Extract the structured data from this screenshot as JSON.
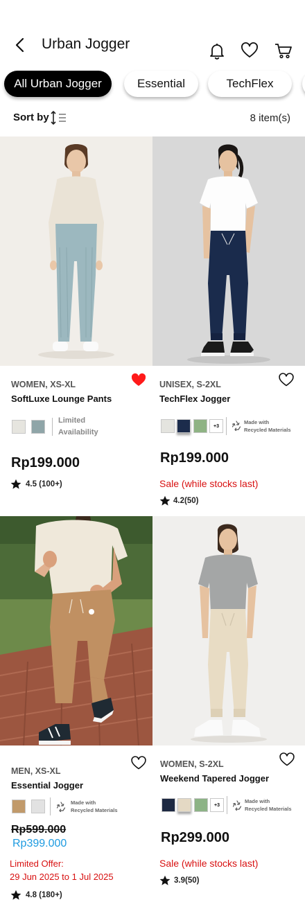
{
  "header": {
    "title": "Urban Jogger"
  },
  "chips": [
    "All Urban Jogger",
    "Essential",
    "TechFlex"
  ],
  "sort": {
    "label": "Sort by",
    "count": "8 item(s)"
  },
  "eco_label_line1": "Made with",
  "eco_label_line2": "Recycled Materials",
  "products": [
    {
      "category": "WOMEN, XS-XL",
      "name": "SoftLuxe Lounge Pants",
      "favorited": true,
      "swatches": [
        "#e6e5df",
        "#8fa5a8"
      ],
      "limited_line1": "Limited",
      "limited_line2": "Availability",
      "price": "Rp199.000",
      "rating": "4.5 (100+)"
    },
    {
      "category": "UNISEX, S-2XL",
      "name": "TechFlex Jogger",
      "favorited": false,
      "swatches": [
        "#e4e4df",
        "#1c2c4c",
        "#8fb384"
      ],
      "more": "+3",
      "price": "Rp199.000",
      "sale": "Sale (while stocks last)",
      "rating": "4.2(50)"
    },
    {
      "category": "MEN, XS-XL",
      "name": "Essential Jogger",
      "favorited": false,
      "swatches": [
        "#c19a6b",
        "#e2e2e2"
      ],
      "old_price": "Rp599.000",
      "new_price": "Rp399.000",
      "offer_line1": "Limited Offer:",
      "offer_line2": "29 Jun 2025 to 1 Jul 2025",
      "rating": "4.8 (180+)"
    },
    {
      "category": "WOMEN, S-2XL",
      "name": "Weekend Tapered Jogger",
      "favorited": false,
      "swatches": [
        "#1d2942",
        "#e4d9c4",
        "#8db386"
      ],
      "more": "+3",
      "price": "Rp299.000",
      "sale": "Sale (while stocks last)",
      "rating": "3.9(50)"
    }
  ],
  "colors": {
    "favorite": "#ff1a1a",
    "sale": "#d81010",
    "discount": "#1e9be0",
    "active_chip": "#000000"
  }
}
